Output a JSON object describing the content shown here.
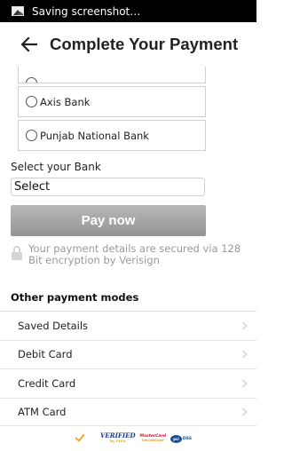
{
  "status_bar": {
    "text": "Saving screenshot…",
    "icon": "image-icon"
  },
  "app_bar": {
    "title": "Complete Your Payment",
    "back_icon": "back-arrow-icon"
  },
  "banks": [
    {
      "label": "Axis Bank"
    },
    {
      "label": "Punjab National Bank"
    }
  ],
  "bank_select": {
    "label": "Select your Bank",
    "value": "Select"
  },
  "pay_button": {
    "label": "Pay now"
  },
  "security_note": {
    "text": "Your payment details are secured via 128 Bit encryption by Verisign",
    "icon": "lock-icon"
  },
  "other_modes": {
    "header": "Other payment modes",
    "items": [
      {
        "label": "Saved Details"
      },
      {
        "label": "Debit Card"
      },
      {
        "label": "Credit Card"
      },
      {
        "label": "ATM Card"
      }
    ]
  },
  "trust_badges": {
    "verified": "VERIFIED",
    "by_visa": "by VISA",
    "mastercard": "MasterCard",
    "securecode": "SecureCode",
    "pci": "DSS"
  },
  "colors": {
    "status_bar": "#000000",
    "pay_button": "#a6a6a6",
    "border": "#cfcfcf"
  }
}
